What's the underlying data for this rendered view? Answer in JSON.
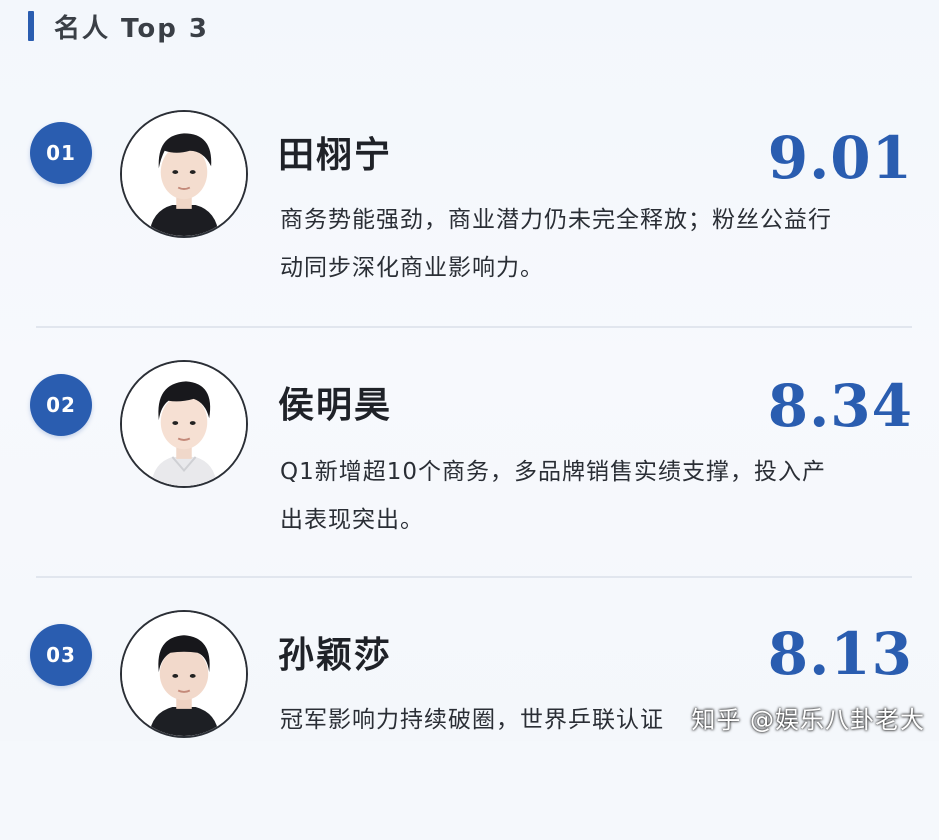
{
  "header": {
    "title": "名人 Top 3"
  },
  "items": [
    {
      "rank": "01",
      "name": "田栩宁",
      "score": "9.01",
      "desc_line1": "商务势能强劲，商业潜力仍未完全释放；粉丝公益行",
      "desc_line2": "动同步深化商业影响力。"
    },
    {
      "rank": "02",
      "name": "侯明昊",
      "score": "8.34",
      "desc_line1": "Q1新增超10个商务，多品牌销售实绩支撑，投入产",
      "desc_line2": "出表现突出。"
    },
    {
      "rank": "03",
      "name": "孙颖莎",
      "score": "8.13",
      "desc_line1": "冠军影响力持续破圈，世界乒联认证",
      "desc_line2": ""
    }
  ],
  "watermark": {
    "text": "知乎 @娱乐八卦老大"
  },
  "colors": {
    "accent": "#2a5db0",
    "background": "#f5f8fc",
    "text": "#22262c"
  }
}
